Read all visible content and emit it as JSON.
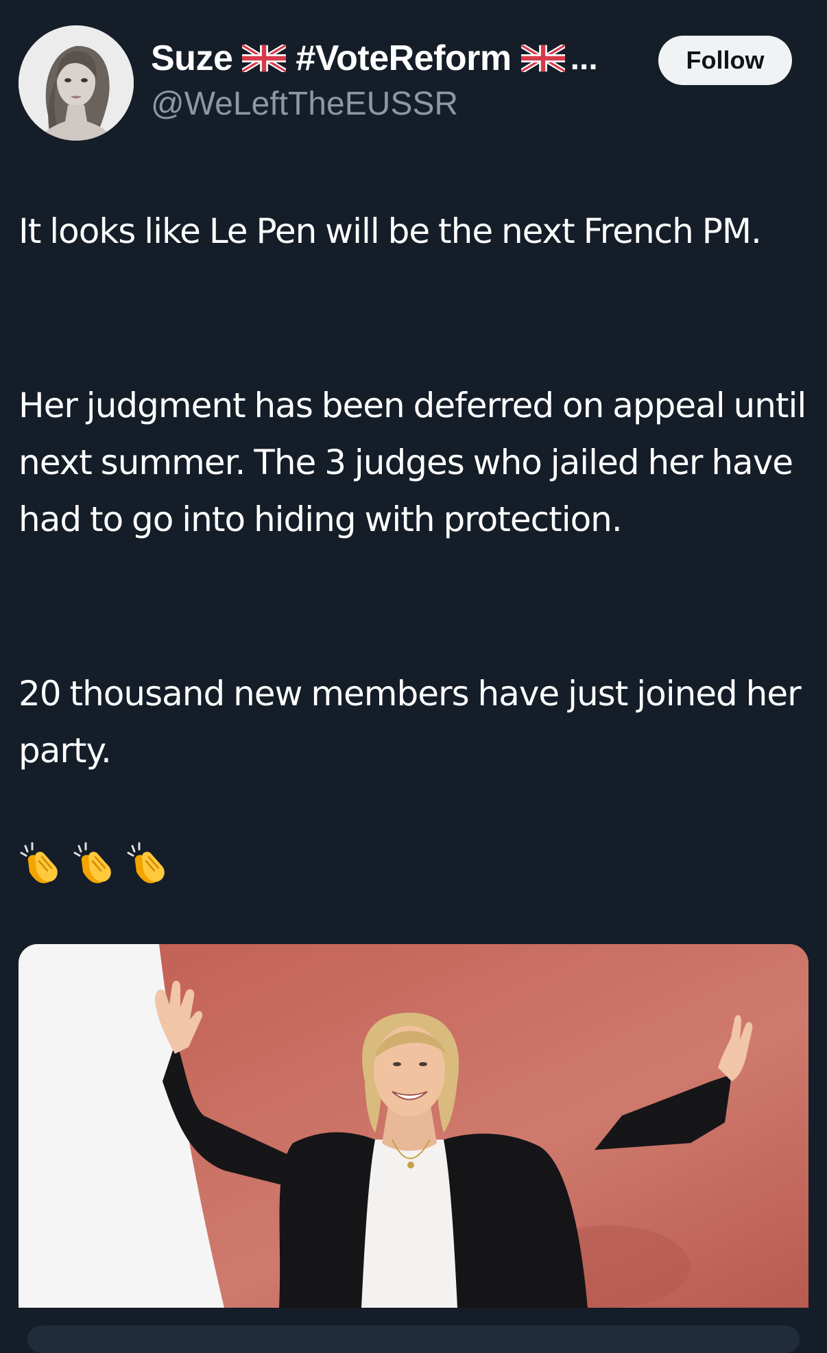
{
  "author": {
    "display_name": "Suze",
    "hashtag": "#VoteReform",
    "truncation": "...",
    "handle": "@WeLeftTheEUSSR",
    "flag_icon": "uk-flag-icon"
  },
  "actions": {
    "follow_label": "Follow"
  },
  "tweet": {
    "paragraphs": [
      "It looks like Le Pen will be the next French PM.",
      "Her judgment has been deferred on appeal until next summer. The 3 judges who jailed her have had to go into hiding with protection.",
      "20 thousand new members have just joined her party."
    ],
    "emoji_icons": [
      "clapping-hands-icon",
      "clapping-hands-icon",
      "clapping-hands-icon"
    ]
  },
  "colors": {
    "background": "#151d28",
    "handle": "#8b98a5",
    "follow_bg": "#eff3f4"
  }
}
